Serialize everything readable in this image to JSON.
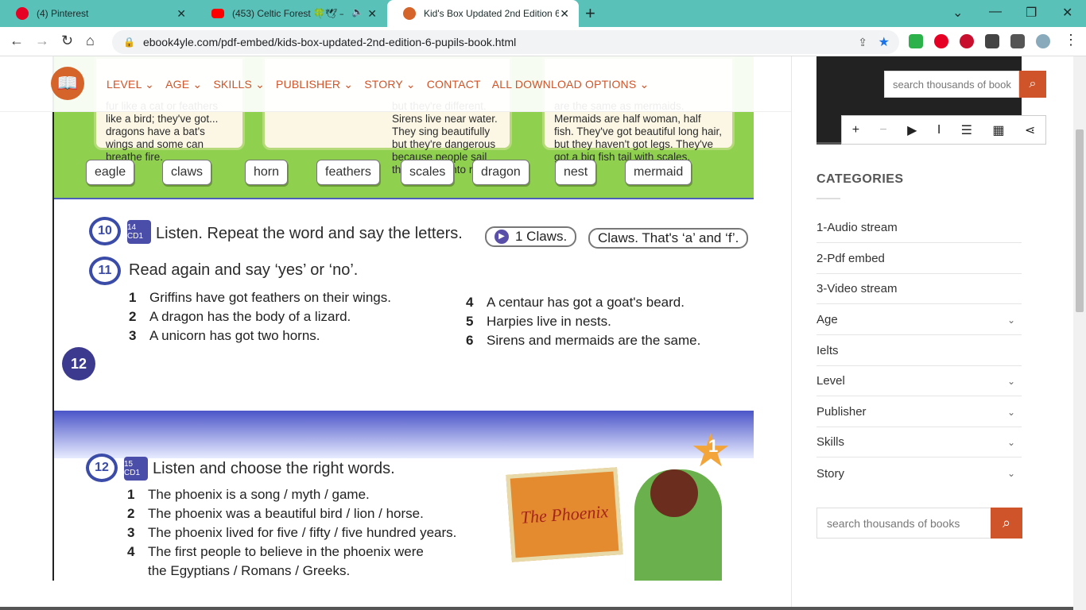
{
  "tabs": [
    {
      "title": "(4) Pinterest",
      "icon": "pinterest-icon",
      "color": "#e60023"
    },
    {
      "title": "(453) Celtic Forest 🍀🕊 — ",
      "icon": "youtube-icon",
      "color": "#ff0000"
    },
    {
      "title": "Kid's Box Updated 2nd Edition 6",
      "icon": "book-icon",
      "color": "#d4642a"
    }
  ],
  "url": "ebook4yle.com/pdf-embed/kids-box-updated-2nd-edition-6-pupils-book.html",
  "site_menu": [
    "LEVEL",
    "AGE",
    "SKILLS",
    "PUBLISHER",
    "STORY",
    "CONTACT",
    "ALL DOWNLOAD OPTIONS"
  ],
  "pdf": {
    "top_texts": [
      "fur like a cat or feathers like a bird; they've got... dragons have a bat's wings and some can breathe fire.",
      "but they're different. Sirens live near water. They sing beautifully but they're dangerous because people sail their boats onto rocks.",
      "are the same as mermaids. Mermaids are half woman, half fish. They've got beautiful long hair, but they haven't got legs. They've got a big fish tail with scales."
    ],
    "words": [
      "eagle",
      "claws",
      "horn",
      "feathers",
      "scales",
      "dragon",
      "nest",
      "mermaid"
    ],
    "ex10": {
      "num": "10",
      "cd": "14 CD1",
      "title": "Listen. Repeat the word and say the letters.",
      "bubble1": "1 Claws.",
      "bubble2": "Claws. That's ‘a’ and ‘f’."
    },
    "ex11": {
      "num": "11",
      "title": "Read again and say ‘yes’ or ‘no’.",
      "items_left": [
        {
          "n": "1",
          "t": "Griffins have got feathers on their wings."
        },
        {
          "n": "2",
          "t": "A dragon has the body of a lizard."
        },
        {
          "n": "3",
          "t": "A unicorn has got two horns."
        }
      ],
      "items_right": [
        {
          "n": "4",
          "t": "A centaur has got a goat's beard."
        },
        {
          "n": "5",
          "t": "Harpies live in nests."
        },
        {
          "n": "6",
          "t": "Sirens and mermaids are the same."
        }
      ]
    },
    "page_number": "12",
    "star_number": "1",
    "ex12": {
      "num": "12",
      "cd": "15 CD1",
      "title": "Listen and choose the right words.",
      "items": [
        {
          "n": "1",
          "t": "The phoenix is a song / myth / game."
        },
        {
          "n": "2",
          "t": "The phoenix was a beautiful bird / lion / horse."
        },
        {
          "n": "3",
          "t": "The phoenix lived for five / fifty / five hundred years."
        },
        {
          "n": "4",
          "t": "The first people to believe in the phoenix were"
        },
        {
          "n": "",
          "t": "the Egyptians / Romans / Greeks."
        }
      ],
      "picture_text": "The Phoenix"
    }
  },
  "sidebar": {
    "search_placeholder": "search thousands of book",
    "categories_title": "CATEGORIES",
    "categories": [
      {
        "label": "1-Audio stream",
        "expand": false
      },
      {
        "label": "2-Pdf embed",
        "expand": false
      },
      {
        "label": "3-Video stream",
        "expand": false
      },
      {
        "label": "Age",
        "expand": true
      },
      {
        "label": "Ielts",
        "expand": false
      },
      {
        "label": "Level",
        "expand": true
      },
      {
        "label": "Publisher",
        "expand": true
      },
      {
        "label": "Skills",
        "expand": true
      },
      {
        "label": "Story",
        "expand": true
      }
    ],
    "search2_placeholder": "search thousands of books"
  }
}
